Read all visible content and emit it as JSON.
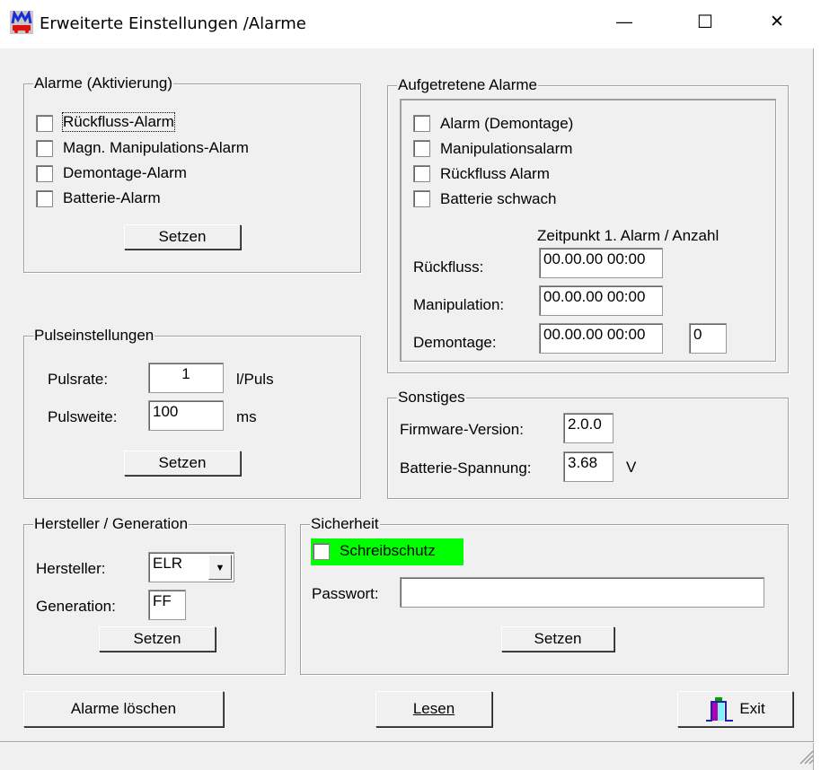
{
  "window": {
    "title": "Erweiterte Einstellungen /Alarme",
    "minimize": "—",
    "maximize": "☐",
    "close": "✕"
  },
  "alarm_activation": {
    "title": "Alarme (Aktivierung)",
    "items": [
      {
        "label": "Rückfluss-Alarm",
        "checked": false
      },
      {
        "label": "Magn. Manipulations-Alarm",
        "checked": false
      },
      {
        "label": "Demontage-Alarm",
        "checked": false
      },
      {
        "label": "Batterie-Alarm",
        "checked": false
      }
    ],
    "set_label": "Setzen"
  },
  "occurred_alarms": {
    "title": "Aufgetretene Alarme",
    "items": [
      {
        "label": "Alarm (Demontage)",
        "checked": false
      },
      {
        "label": "Manipulationsalarm",
        "checked": false
      },
      {
        "label": "Rückfluss Alarm",
        "checked": false
      },
      {
        "label": "Batterie schwach",
        "checked": false
      }
    ],
    "column_header": "Zeitpunkt 1. Alarm / Anzahl",
    "rows": [
      {
        "label": "Rückfluss:",
        "time": "00.00.00 00:00"
      },
      {
        "label": "Manipulation:",
        "time": "00.00.00 00:00"
      },
      {
        "label": "Demontage:",
        "time": "00.00.00 00:00",
        "count": "0"
      }
    ]
  },
  "pulse": {
    "title": "Pulseinstellungen",
    "rate_label": "Pulsrate:",
    "rate_value": "1",
    "rate_unit": "l/Puls",
    "width_label": "Pulsweite:",
    "width_value": "100",
    "width_unit": "ms",
    "set_label": "Setzen"
  },
  "misc": {
    "title": "Sonstiges",
    "firmware_label": "Firmware-Version:",
    "firmware_value": "2.0.0",
    "battery_label": "Batterie-Spannung:",
    "battery_value": "3.68",
    "battery_unit": "V"
  },
  "manufacturer": {
    "title": "Hersteller / Generation",
    "maker_label": "Hersteller:",
    "maker_value": "ELR",
    "generation_label": "Generation:",
    "generation_value": "FF",
    "set_label": "Setzen"
  },
  "security": {
    "title": "Sicherheit",
    "write_protect_label": "Schreibschutz",
    "write_protect_checked": false,
    "highlight_color": "#00ff00",
    "password_label": "Passwort:",
    "password_value": "",
    "set_label": "Setzen"
  },
  "footer": {
    "clear_label": "Alarme löschen",
    "read_label": "Lesen",
    "exit_label": "Exit"
  }
}
